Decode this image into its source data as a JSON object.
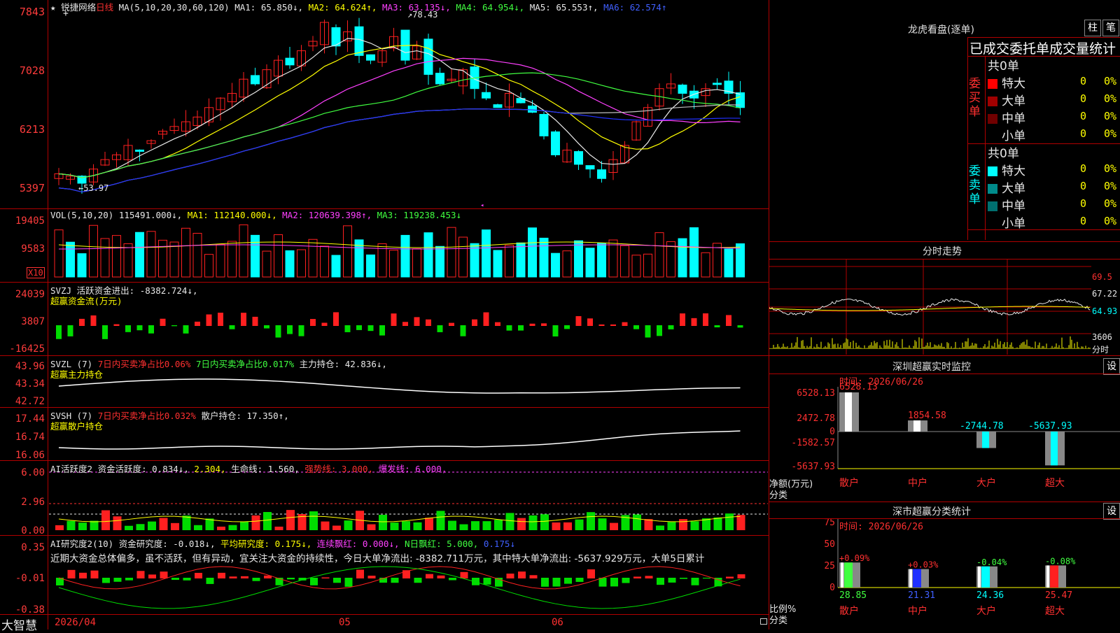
{
  "stock": {
    "name": "锐捷网络",
    "period": "日线",
    "star": "★"
  },
  "ma_header": {
    "label": "MA(5,10,20,30,60,120)",
    "ma1": "MA1: 65.850↓,",
    "ma2": "MA2: 64.624↑,",
    "ma3": "MA3: 63.135↓,",
    "ma4": "MA4: 64.954↓,",
    "ma5": "MA5: 65.553↑,",
    "ma6": "MA6: 62.574↑"
  },
  "price_axis": [
    "7843",
    "7028",
    "6213",
    "5397"
  ],
  "price_marks": {
    "high": "78.43",
    "low": "53.97"
  },
  "vol_header": {
    "label": "VOL(5,10,20)",
    "value": "115491.000↓,",
    "ma1": "MA1: 112140.000↓,",
    "ma2": "MA2: 120639.398↑,",
    "ma3": "MA3: 119238.453↓"
  },
  "vol_axis": [
    "19405",
    "9583"
  ],
  "vol_unit": "X10",
  "svzj_header": {
    "label": "SVZJ",
    "text": "活跃资金进出: -8382.724↓,",
    "sub": "超赢资金流(万元)"
  },
  "svzj_axis": [
    "24039",
    "3807",
    "-16425"
  ],
  "svzl_header": {
    "label": "SVZL (7)",
    "t1": "7日内买卖净占比0.06%",
    "t2": "7日内买卖净占比0.017%",
    "t3": "主力持仓: 42.836↓,",
    "sub": "超赢主力持仓"
  },
  "svzl_axis": [
    "43.96",
    "43.34",
    "42.72"
  ],
  "svsh_header": {
    "label": "SVSH (7)",
    "t1": "7日内买卖净占比0.032%",
    "t2": "散户持仓: 17.350↑,",
    "sub": "超赢散户持仓"
  },
  "svsh_axis": [
    "17.44",
    "16.74",
    "16.06"
  ],
  "ai1_header": {
    "label": "AI活跃度2",
    "t1": "资金活跃度: 0.834↓,",
    "t2": "2.304,",
    "t3": "生命线: 1.560,",
    "t4": "强势线: 3.000,",
    "t5": "爆发线: 6.000,"
  },
  "ai1_axis": [
    "6.00",
    "2.96",
    "0.00"
  ],
  "ai2_header": {
    "label": "AI研究度2(10)",
    "t1": "资金研究度: -0.018↓,",
    "t2": "平均研究度: 0.175↓,",
    "t3": "连续飘红: 0.000↓,",
    "t4": "N日飘红: 5.000,",
    "t5": "0.175↓"
  },
  "ai2_axis": [
    "0.35",
    "-0.01",
    "-0.38"
  ],
  "ai2_comment": "近期大资金总体偏多，虽不活跃，但有异动，宜关注大资金的持续性，今日大单净流出: -8382.711万元，其中特大单净流出: -5637.929万元，大单5日累计",
  "bottom": {
    "brand": "大智慧",
    "date": "2026/04",
    "m05": "05",
    "m06": "06"
  },
  "dragon": {
    "title": "龙虎看盘(逐单)",
    "btn1": "柱",
    "btn2": "笔",
    "header": "已成交委托单成交量统计",
    "buy_label": "委买单",
    "sell_label": "委卖单",
    "buy_total": "共0单",
    "sell_total": "共0单",
    "buy_rows": [
      {
        "name": "特大",
        "count": "0",
        "pct": "0%",
        "color": "#ff0000"
      },
      {
        "name": "大单",
        "count": "0",
        "pct": "0%",
        "color": "#a00000"
      },
      {
        "name": "中单",
        "count": "0",
        "pct": "0%",
        "color": "#700000"
      },
      {
        "name": "小单",
        "count": "0",
        "pct": "0%",
        "color": "#000000"
      }
    ],
    "sell_rows": [
      {
        "name": "特大",
        "count": "0",
        "pct": "0%",
        "color": "#00ffff"
      },
      {
        "name": "大单",
        "count": "0",
        "pct": "0%",
        "color": "#008c8c"
      },
      {
        "name": "中单",
        "count": "0",
        "pct": "0%",
        "color": "#007070"
      },
      {
        "name": "小单",
        "count": "0",
        "pct": "0%",
        "color": "#000000"
      }
    ]
  },
  "intraday": {
    "title": "分时走势",
    "axis": [
      "69.5",
      "67.22",
      "64.93",
      "3606"
    ],
    "unit": "分时"
  },
  "monitor": {
    "title": "深圳超赢实时监控",
    "btn": "设",
    "time": "时间: 2026/06/26",
    "axis": [
      "6528.13",
      "2472.78",
      "0",
      "-1582.57",
      "-5637.93"
    ],
    "ylabel": "净额(万元)",
    "xlabel": "分类",
    "cats": [
      "散户",
      "中户",
      "大户",
      "超大"
    ],
    "values": [
      "6528.13",
      "1854.58",
      "-2744.78",
      "-5637.93"
    ]
  },
  "classify": {
    "title": "深市超赢分类统计",
    "btn": "设",
    "time": "时间: 2026/06/26",
    "axis": [
      "75",
      "50",
      "25",
      "0"
    ],
    "ylabel": "比例%",
    "xlabel": "分类",
    "cats": [
      "散户",
      "中户",
      "大户",
      "超大"
    ],
    "tops": [
      "+0.09%",
      "+0.03%",
      "-0.04%",
      "-0.08%"
    ],
    "bottoms": [
      "28.85",
      "21.31",
      "24.36",
      "25.47"
    ]
  }
}
